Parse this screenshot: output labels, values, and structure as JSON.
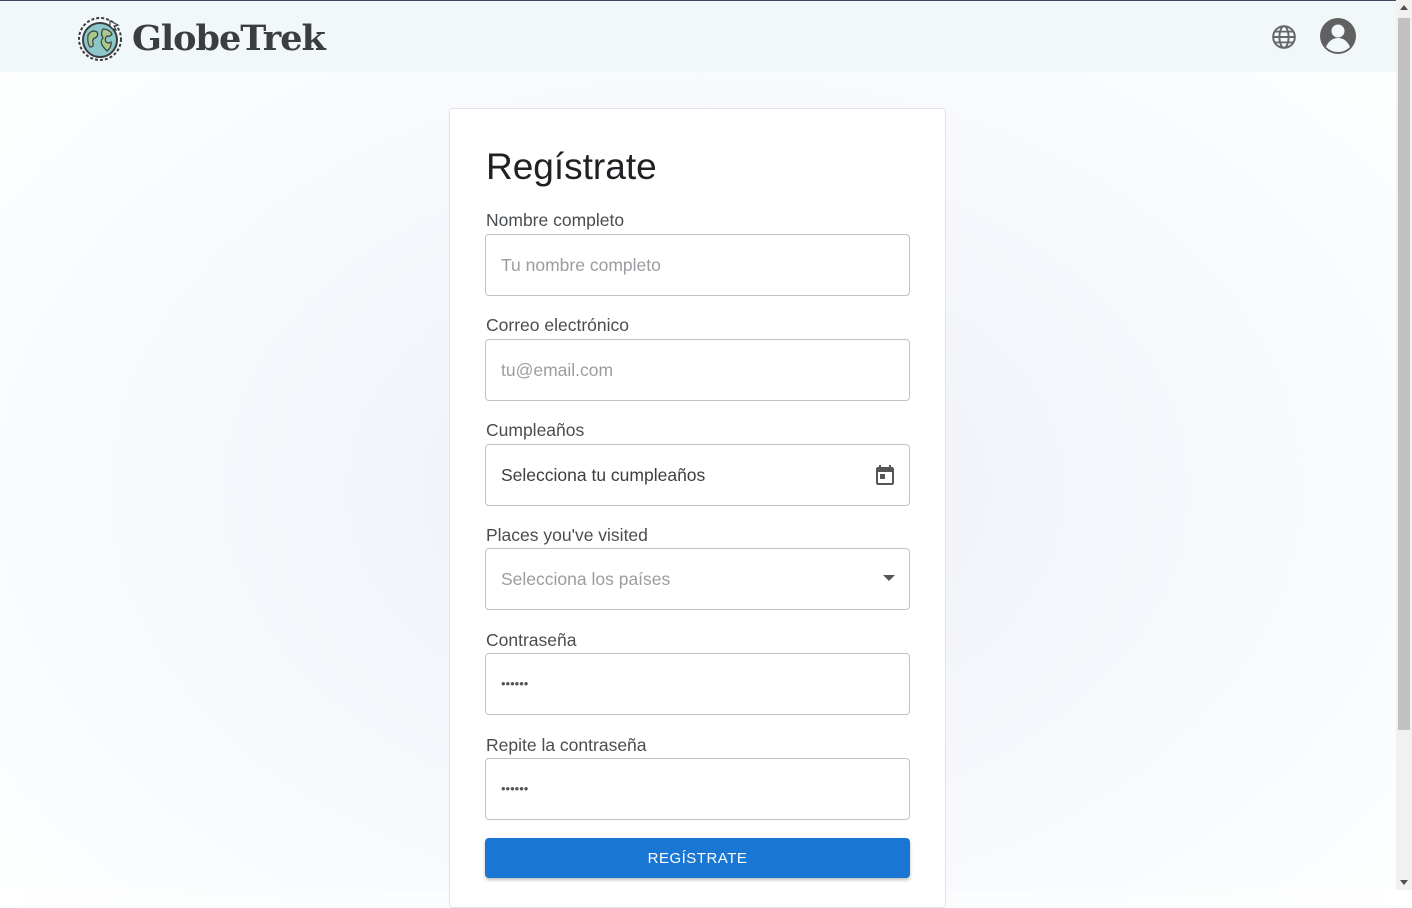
{
  "app": {
    "brand_name": "GlobeTrek"
  },
  "header": {
    "language_icon": "globe-icon",
    "account_icon": "account-circle-icon"
  },
  "form": {
    "title": "Regístrate",
    "fields": {
      "full_name": {
        "label": "Nombre completo",
        "placeholder": "Tu nombre completo",
        "value": ""
      },
      "email": {
        "label": "Correo electrónico",
        "placeholder": "tu@email.com",
        "value": ""
      },
      "birthday": {
        "label": "Cumpleaños",
        "value": "Selecciona tu cumpleaños",
        "icon": "calendar-icon"
      },
      "places": {
        "label": "Places you've visited",
        "placeholder": "Selecciona los países",
        "icon": "dropdown-arrow-icon"
      },
      "password": {
        "label": "Contraseña",
        "value": "••••••"
      },
      "password_repeat": {
        "label": "Repite la contraseña",
        "value": "••••••"
      }
    },
    "submit_label": "REGÍSTRATE"
  },
  "colors": {
    "primary": "#1976d2",
    "header_bg": "#f2f7fa",
    "brand_text": "#3b3e41"
  }
}
